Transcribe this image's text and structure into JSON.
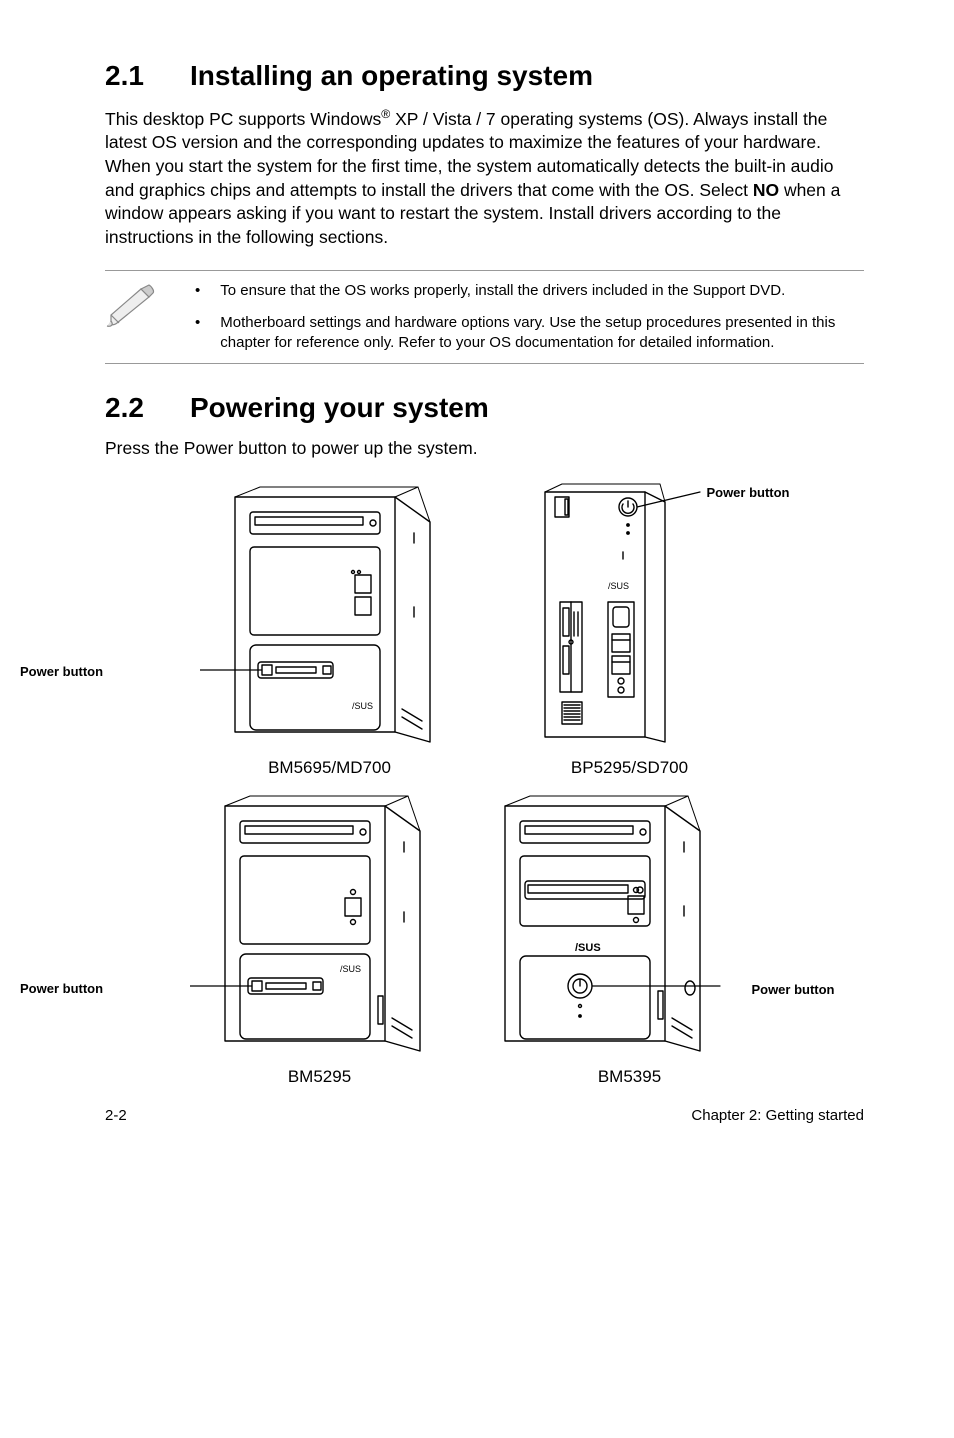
{
  "section1": {
    "number": "2.1",
    "title": "Installing an operating system",
    "para_1": "This desktop PC supports Windows",
    "para_sup": "®",
    "para_2": " XP / Vista / 7 operating systems (OS). Always install the latest OS version and the corresponding updates to maximize the features of your hardware. When you start the system for the first time, the system automatically detects the built-in audio and graphics chips and attempts to install the drivers that come with the OS. Select ",
    "para_bold": "NO",
    "para_3": " when a window appears asking if you want to restart the system. Install drivers according to the instructions in the following sections.",
    "notes": [
      "To ensure that the OS works properly, install the drivers included in the Support DVD.",
      "Motherboard settings and hardware options vary. Use the setup procedures presented in this chapter for reference only. Refer to your OS documentation for detailed information."
    ]
  },
  "section2": {
    "number": "2.2",
    "title": "Powering your system",
    "para": "Press the Power button to power up the system."
  },
  "labels": {
    "power_button": "Power button"
  },
  "captions": {
    "tl": "BM5695/MD700",
    "tr": "BP5295/SD700",
    "bl": "BM5295",
    "br": "BM5395"
  },
  "footer": {
    "left": "2-2",
    "right": "Chapter 2: Getting started"
  }
}
